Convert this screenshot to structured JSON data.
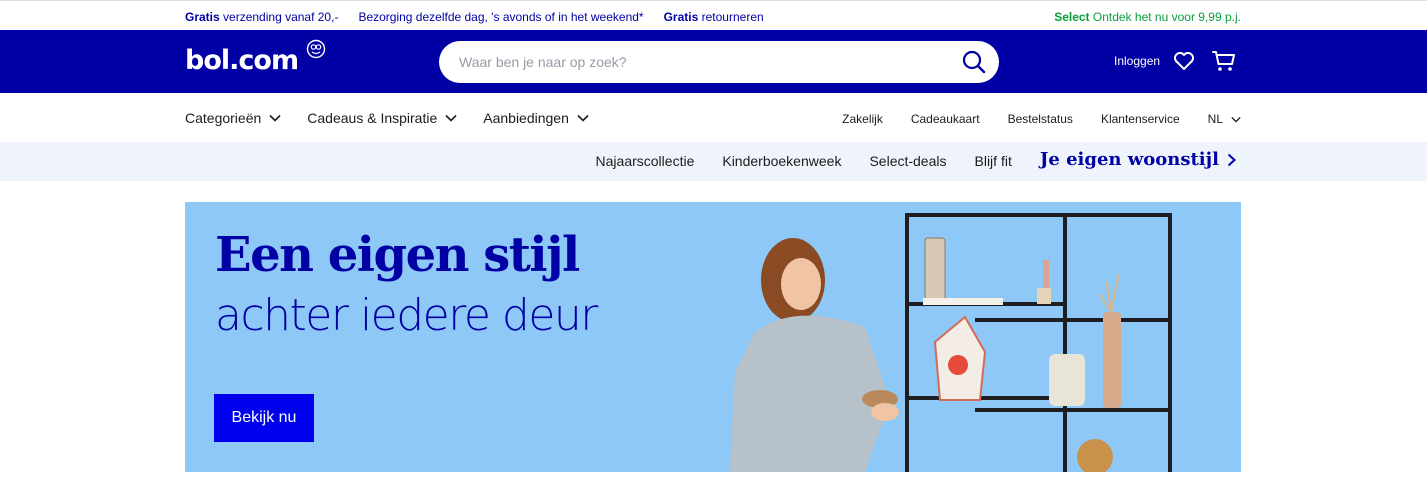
{
  "usp": {
    "item1_bold": "Gratis",
    "item1_rest": "verzending vanaf 20,-",
    "item2": "Bezorging dezelfde dag, 's avonds of in het weekend*",
    "item3_bold": "Gratis",
    "item3_rest": "retourneren",
    "select_bold": "Select",
    "select_rest": "Ontdek het nu voor 9,99 p.j."
  },
  "header": {
    "logo": "bol.com",
    "search_placeholder": "Waar ben je naar op zoek?",
    "login": "Inloggen"
  },
  "nav": {
    "left": [
      "Categorieën",
      "Cadeaus & Inspiratie",
      "Aanbiedingen"
    ],
    "right": [
      "Zakelijk",
      "Cadeaukaart",
      "Bestelstatus",
      "Klantenservice"
    ],
    "language": "NL"
  },
  "subnav": {
    "items": [
      "Najaarscollectie",
      "Kinderboekenweek",
      "Select-deals",
      "Blijf fit"
    ],
    "feature": "Je eigen woonstijl"
  },
  "banner": {
    "title": "Een eigen stijl",
    "subtitle": "achter iedere deur",
    "button": "Bekijk nu"
  },
  "colors": {
    "brand": "#0000a4",
    "select_green": "#0a9e3c",
    "banner_bg": "#8ec8f6",
    "button": "#0000ee"
  },
  "icons": [
    "search-icon",
    "heart-icon",
    "cart-icon",
    "chevron-down-icon",
    "chevron-right-icon"
  ]
}
